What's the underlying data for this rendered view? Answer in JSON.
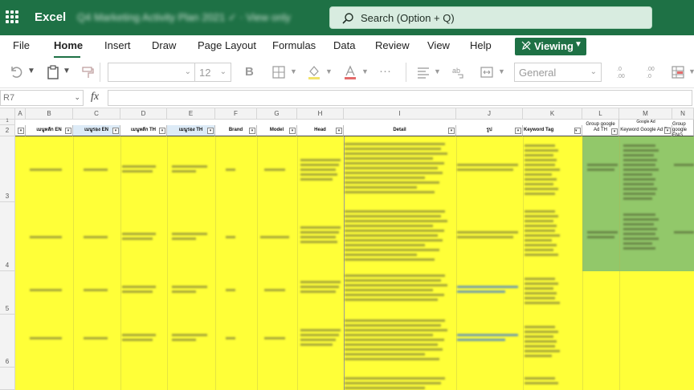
{
  "titlebar": {
    "app_name": "Excel",
    "doc_title": "Q4 Marketing Activity Plan 2021 ✓ · View only",
    "search_placeholder": "Search (Option + Q)"
  },
  "tabs": [
    "File",
    "Home",
    "Insert",
    "Draw",
    "Page Layout",
    "Formulas",
    "Data",
    "Review",
    "View",
    "Help"
  ],
  "active_tab": "Home",
  "viewing_button": "Viewing",
  "toolbar": {
    "font_name": "",
    "font_size": "12",
    "bold": "B",
    "number_format": "General",
    "more": "···"
  },
  "formula_bar": {
    "name_box": "R7",
    "fx": "fx",
    "formula": ""
  },
  "columns": [
    "A",
    "B",
    "C",
    "D",
    "E",
    "F",
    "G",
    "H",
    "I",
    "J",
    "K",
    "L",
    "M",
    "N"
  ],
  "rows": [
    "1",
    "2",
    "3",
    "4",
    "5",
    "6"
  ],
  "row1": {
    "M": "Google Ad"
  },
  "headers": {
    "B": "เมนูหลัก EN",
    "C": "เมนูรอง EN",
    "D": "เมนูหลัก TH",
    "E": "เมนูรอง TH",
    "F": "Brand",
    "G": "Model",
    "H": "Head",
    "I": "Detail",
    "J": "รูป",
    "K": "Keyword Tag",
    "L": "Group google Ad TH",
    "M": "Keyword Google Ad TH",
    "N": "Group google ENG"
  },
  "colors": {
    "excel_green": "#1e7145",
    "cell_yellow": "#ffff38",
    "cell_green": "#92c86a",
    "header_blue": "#ddebf7"
  }
}
